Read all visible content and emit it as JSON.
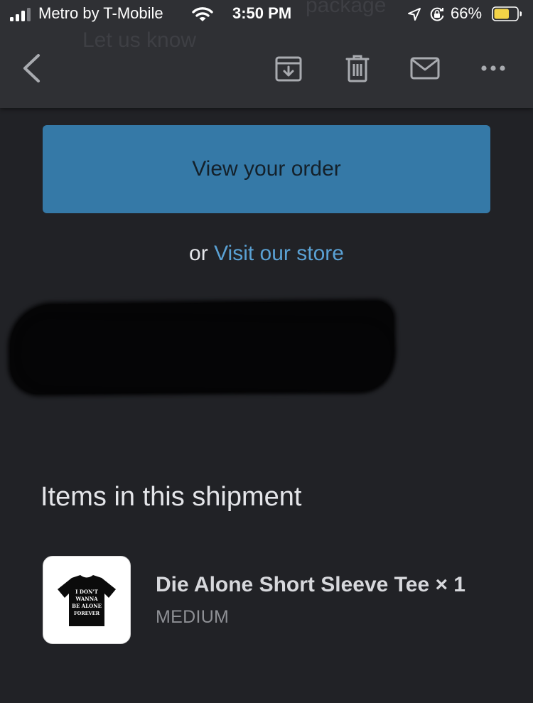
{
  "status_bar": {
    "carrier": "Metro by T-Mobile",
    "time": "3:50 PM",
    "battery_percent": "66%",
    "battery_level": 0.66,
    "battery_color": "#f3d347",
    "signal_bars": 3,
    "signal_bars_total": 4,
    "icons": [
      "signal-icon",
      "wifi-icon",
      "location-arrow-icon",
      "orientation-lock-icon",
      "battery-icon"
    ]
  },
  "background_ghost": {
    "line1": "package",
    "line2": "Let us know"
  },
  "toolbar": {
    "icons": [
      "back-chevron-icon",
      "archive-icon",
      "trash-icon",
      "mail-icon",
      "more-icon"
    ]
  },
  "email": {
    "view_order_label": "View your order",
    "or_text": "or",
    "visit_store_label": "Visit our store",
    "items_heading": "Items in this shipment",
    "items": [
      {
        "name": "Die Alone Short Sleeve Tee × 1",
        "variant": "MEDIUM",
        "thumbnail_text": "I DON'T WANNA BE ALONE FOREVER"
      }
    ]
  },
  "colors": {
    "background": "#212226",
    "toolbar_background": "#2f3034",
    "button_blue": "#3579a7",
    "link_blue": "#5aa1d4"
  }
}
